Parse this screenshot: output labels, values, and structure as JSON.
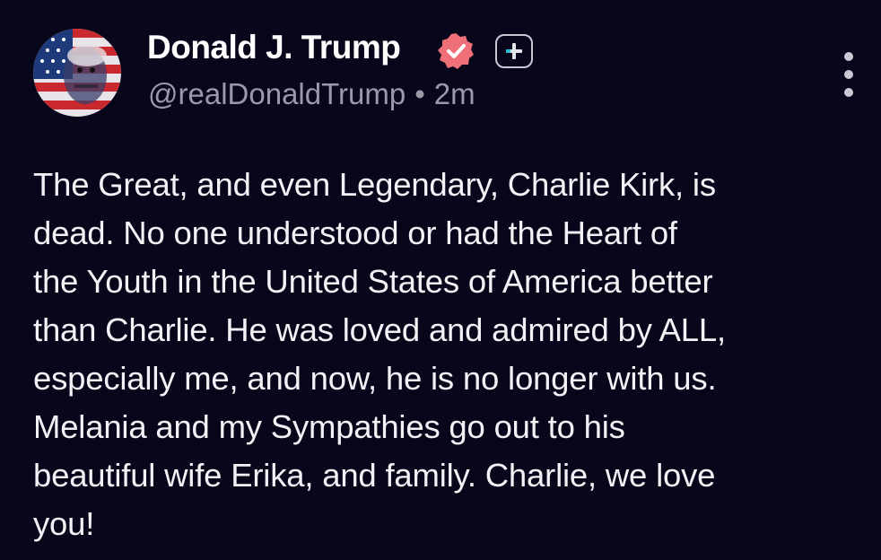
{
  "post": {
    "author": {
      "display_name": "Donald J. Trump",
      "handle": "@realDonaldTrump",
      "verified_icon": "verified-badge-icon",
      "avatar": "profile-avatar"
    },
    "separator": "•",
    "timestamp": "2m",
    "subscribe_icon": "add-plus-icon",
    "more_icon": "more-vertical-icon",
    "body_lines": [
      "The Great, and even Legendary, Charlie Kirk, is",
      "dead. No one understood or had the Heart of",
      "the Youth in the United States of America better",
      "than Charlie. He was loved and admired by ALL,",
      "especially me, and now, he is no longer with us.",
      "Melania and my Sympathies go out to his",
      "beautiful wife Erika, and family. Charlie, we love",
      "you!"
    ]
  },
  "colors": {
    "background": "#07061a",
    "text": "#f2f2f6",
    "secondary_text": "#9a99a8",
    "verified_badge": "#f0707a"
  }
}
